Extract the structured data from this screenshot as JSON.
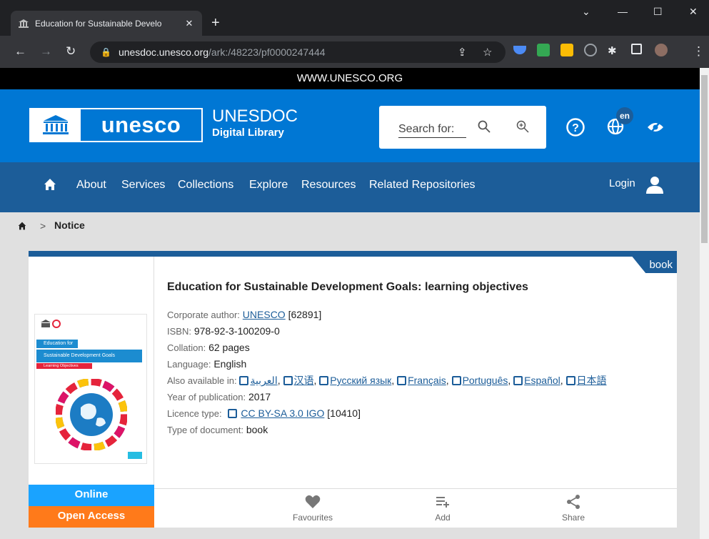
{
  "browser": {
    "tab_title": "Education for Sustainable Develo",
    "tab_close": "✕",
    "new_tab": "+",
    "url_host": "unesdoc.unesco.org",
    "url_path": "/ark:/48223/pf0000247444",
    "window_controls": [
      "⌄",
      "—",
      "☐",
      "✕"
    ]
  },
  "site": {
    "top_banner": "WWW.UNESCO.ORG",
    "logo_text": "unesco",
    "product_name": "UNESDOC",
    "product_sub": "Digital Library",
    "search_placeholder": "Search for:",
    "lang_badge": "en"
  },
  "nav": {
    "items": [
      "About",
      "Services",
      "Collections",
      "Explore",
      "Resources",
      "Related Repositories"
    ],
    "login": "Login"
  },
  "breadcrumb": {
    "current": "Notice",
    "separator": ">"
  },
  "record": {
    "type_tag": "book",
    "title": "Education for Sustainable Development Goals: learning objectives",
    "corporate_author_label": "Corporate author:",
    "corporate_author": "UNESCO",
    "corporate_author_id": "[62891]",
    "isbn_label": "ISBN:",
    "isbn": "978-92-3-100209-0",
    "collation_label": "Collation:",
    "collation": "62 pages",
    "language_label": "Language:",
    "language": "English",
    "also_available_label": "Also available in:",
    "also_available": [
      "العربية",
      "汉语",
      "Русский язык",
      "Français",
      "Português",
      "Español",
      "日本語"
    ],
    "year_label": "Year of publication:",
    "year": "2017",
    "licence_label": "Licence type:",
    "licence": "CC BY-SA 3.0 IGO",
    "licence_id": "[10410]",
    "doctype_label": "Type of document:",
    "doctype": "book",
    "cover_lines": [
      "Education for",
      "Sustainable Development Goals",
      "Learning Objectives"
    ],
    "badge_online": "Online",
    "badge_open": "Open Access"
  },
  "actions": {
    "favourites": "Favourites",
    "add": "Add",
    "share": "Share"
  },
  "colors": {
    "unesco_blue": "#0077d4",
    "nav_blue": "#1c5d99",
    "online": "#1aa3ff",
    "open_access": "#ff7a1a"
  }
}
